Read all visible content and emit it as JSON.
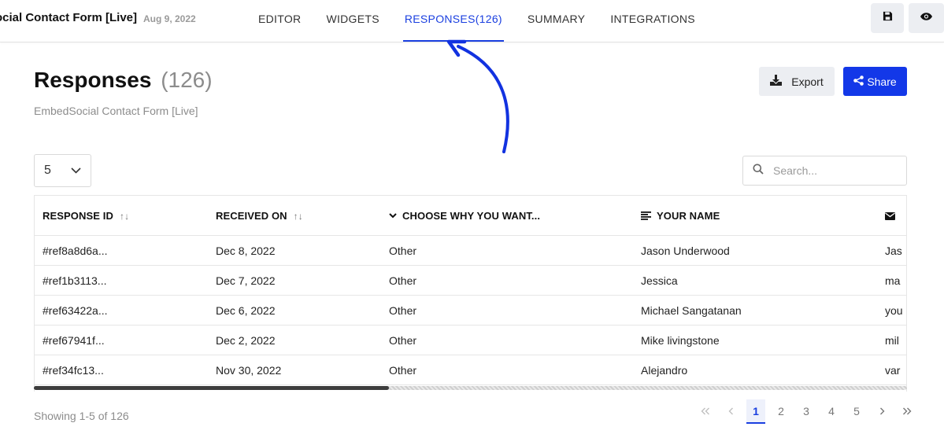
{
  "topbar": {
    "form_title": "ocial Contact Form [Live]",
    "form_date": "Aug 9, 2022",
    "tabs": [
      {
        "label": "EDITOR",
        "active": false
      },
      {
        "label": "WIDGETS",
        "active": false
      },
      {
        "label": "RESPONSES(126)",
        "active": true
      },
      {
        "label": "SUMMARY",
        "active": false
      },
      {
        "label": "INTEGRATIONS",
        "active": false
      }
    ],
    "tools": {
      "save_icon": "floppy-disk-icon",
      "preview_icon": "eye-icon"
    }
  },
  "header": {
    "title": "Responses",
    "count": "(126)",
    "subtitle": "EmbedSocial Contact Form [Live]",
    "export_label": "Export",
    "share_label": "Share"
  },
  "controls": {
    "page_size": "5",
    "search_placeholder": "Search..."
  },
  "table": {
    "columns": [
      {
        "label": "RESPONSE ID",
        "sortable": true,
        "icon": ""
      },
      {
        "label": "RECEIVED ON",
        "sortable": true,
        "icon": ""
      },
      {
        "label": "CHOOSE WHY YOU WANT...",
        "sortable": false,
        "icon": "chevron-down-icon"
      },
      {
        "label": "YOUR NAME",
        "sortable": false,
        "icon": "text-lines-icon"
      },
      {
        "label": "",
        "sortable": false,
        "icon": "envelope-icon"
      }
    ],
    "rows": [
      [
        "#ref8a8d6a...",
        "Dec 8, 2022",
        "Other",
        "Jason Underwood",
        "Jas"
      ],
      [
        "#ref1b3113...",
        "Dec 7, 2022",
        "Other",
        "Jessica",
        "ma"
      ],
      [
        "#ref63422a...",
        "Dec 6, 2022",
        "Other",
        "Michael Sangatanan",
        "you"
      ],
      [
        "#ref67941f...",
        "Dec 2, 2022",
        "Other",
        "Mike livingstone",
        "mil"
      ],
      [
        "#ref34fc13...",
        "Nov 30, 2022",
        "Other",
        "Alejandro",
        "var"
      ]
    ]
  },
  "footer": {
    "showing": "Showing 1-5 of 126",
    "pages": [
      "1",
      "2",
      "3",
      "4",
      "5"
    ],
    "current_page": "1"
  },
  "colors": {
    "accent": "#1a3fe0",
    "share_bg": "#1338e8",
    "button_gray": "#eceef2",
    "annotation_arrow": "#1232e0"
  }
}
